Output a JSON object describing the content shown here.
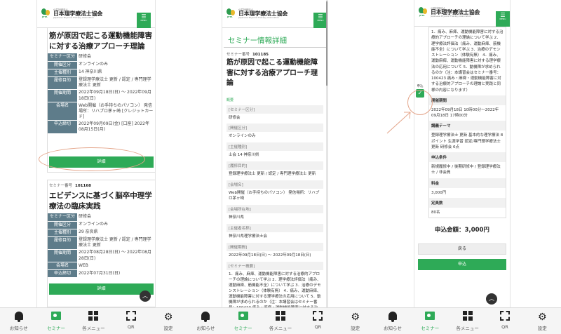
{
  "logo": {
    "org_small": "公益社団法人",
    "org_name": "日本理学療法士協会",
    "org_en": "Japanese Physical Therapy Association",
    "mark": "JPTA"
  },
  "menu_label": "MENU",
  "panel1": {
    "card1": {
      "title": "筋が原因で起こる運動機能障害に対する治療アプローチ理論",
      "rows": [
        {
          "k": "セミナー区分",
          "v": "研修会"
        },
        {
          "k": "開催区分",
          "v": "オンラインのみ"
        },
        {
          "k": "主催種別",
          "v": "14 神奈川県"
        },
        {
          "k": "履修目的",
          "v": "登録理学療法士 更新 / 認定 / 専門理学療法士 更新"
        },
        {
          "k": "開催期間",
          "v": "2022年09月18日(日) 〜 2022年09月18日(日)"
        },
        {
          "k": "会場名",
          "v": "Web開催（お手持ちのパソコン） 発信場所：リハプロ茅ヶ崎 [クレジットカード]"
        },
        {
          "k": "申込締切",
          "v": "2022年09月09日(金) [口座] 2022年08月15日(月)"
        }
      ],
      "button": "詳細"
    },
    "card2": {
      "num_label": "セミナー番号",
      "num": "101168",
      "title": "エビデンスに基づく脳卒中理学療法の臨床実践",
      "rows": [
        {
          "k": "セミナー区分",
          "v": "研修会"
        },
        {
          "k": "開催区分",
          "v": "オンラインのみ"
        },
        {
          "k": "主催種別",
          "v": "29 奈良県"
        },
        {
          "k": "履修目的",
          "v": "登録理学療法士 更新 / 認定 / 専門理学療法士 更新"
        },
        {
          "k": "開催期間",
          "v": "2022年08月28日(日) 〜 2022年08月28日(日)"
        },
        {
          "k": "会場名",
          "v": "WEB"
        },
        {
          "k": "申込締切",
          "v": "2022年07月31日(日)"
        }
      ],
      "button": "詳細"
    }
  },
  "panel2": {
    "section_title": "セミナー情報詳細",
    "num_label": "セミナー番号",
    "num": "101185",
    "title": "筋が原因で起こる運動機能障害に対する治療アプローチ理論",
    "tag": "概要",
    "items": [
      {
        "k": "[セミナー区分]",
        "v": "研修会"
      },
      {
        "k": "[開催区分]",
        "v": "オンラインのみ"
      },
      {
        "k": "[主催種別]",
        "v": "士会 14 神奈川県"
      },
      {
        "k": "[履修目的]",
        "v": "登録理学療法士 更新 / 認定 / 専門理学療法士 更新"
      },
      {
        "k": "[会場名]",
        "v": "Web開催（お手持ちのパソコン） 発信場所：リハプロ茅ヶ崎"
      },
      {
        "k": "[会場所在地]",
        "v": "神奈川県"
      },
      {
        "k": "[主催者名称]",
        "v": "神奈川県理学療法士会"
      },
      {
        "k": "[開催期間]",
        "v": "2022年09月18日(日) 〜 2022年09月18日(日)"
      },
      {
        "k": "[セミナー概要]",
        "v": "1．痛み、麻痺、運動機能障害に対する治療的アプローチの理論について学ぶ 2．理学療法評価法（痛み、運動麻痺、筋機能不全）について学ぶ 3．治療のデモンストレーション（体験有無） 4．痛み、運動麻痺、運動機能障害に対する理学療法の応用について 5．動機障が求められるのか（注：本講習会はセミナー番号：100423 痛み・麻痺・運動機能障害に対する治療的アプローチの"
      }
    ]
  },
  "panel3": {
    "overview_text": "1．痛み、麻痺、運動機能障害に対する治療的アプローチの理論について学ぶ 2．理学療法評価法（痛み、運動麻痺、筋機能不全）について学ぶ 3．治療のデモンストレーション（体験有無） 4．痛み、運動麻痺、運動機能障害に対する理学療法の応用について 5．動機障が求められるのか（注：本講習会はセミナー番号：100423 痛み・麻痺・運動機能障害に対する治療的アプローチの理論と実践と同様の内容になります）",
    "checkbox_label": "申込",
    "items": [
      {
        "k": "開催期間",
        "v": "2022年09月18日 10時00分～2022年09月18日 17時00分"
      },
      {
        "k": "講義テーマ",
        "v": "登録理学療法士 更新 基本的な理学療法 8ポイント 生涯学習 認定/専門理学療法士 更新 研修会 6点"
      },
      {
        "k": "申込条件",
        "v": "新規履修中 / 後期研修中 / 登録理学療法士 / 非会員"
      },
      {
        "k": "料金",
        "v": "3,000円"
      },
      {
        "k": "定員数",
        "v": "80名"
      }
    ],
    "total": "申込金額：3,000円",
    "back_button": "戻る",
    "apply_button": "申込"
  },
  "nav": [
    {
      "label": "お知らせ",
      "icon": "bell-icon"
    },
    {
      "label": "セミナー",
      "icon": "seminar-icon",
      "active": true
    },
    {
      "label": "各メニュー",
      "icon": "grid-icon"
    },
    {
      "label": "QR",
      "icon": "qr-icon"
    },
    {
      "label": "設定",
      "icon": "gear-icon"
    }
  ],
  "accent_color": "#2eaa57",
  "highlight_color": "#e4a58a"
}
